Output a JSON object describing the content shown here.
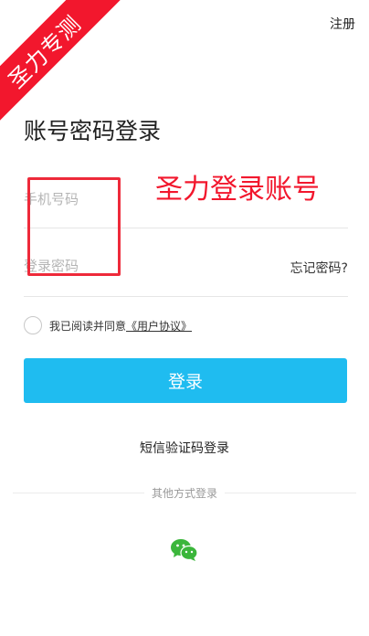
{
  "ribbon": {
    "label": "圣力专测"
  },
  "header": {
    "register_label": "注册"
  },
  "page": {
    "title": "账号密码登录"
  },
  "annotation": {
    "text": "圣力登录账号"
  },
  "form": {
    "phone_placeholder": "手机号码",
    "password_placeholder": "登录密码",
    "forgot_label": "忘记密码?"
  },
  "agreement": {
    "prefix": "我已阅读并同意",
    "link_label": "《用户协议》"
  },
  "actions": {
    "login_label": "登录",
    "sms_login_label": "短信验证码登录"
  },
  "other_login": {
    "divider_label": "其他方式登录",
    "wechat_icon": "wechat-icon"
  },
  "colors": {
    "accent": "#1fbcf0",
    "ribbon": "#f2172d",
    "wechat": "#3bb63b"
  }
}
